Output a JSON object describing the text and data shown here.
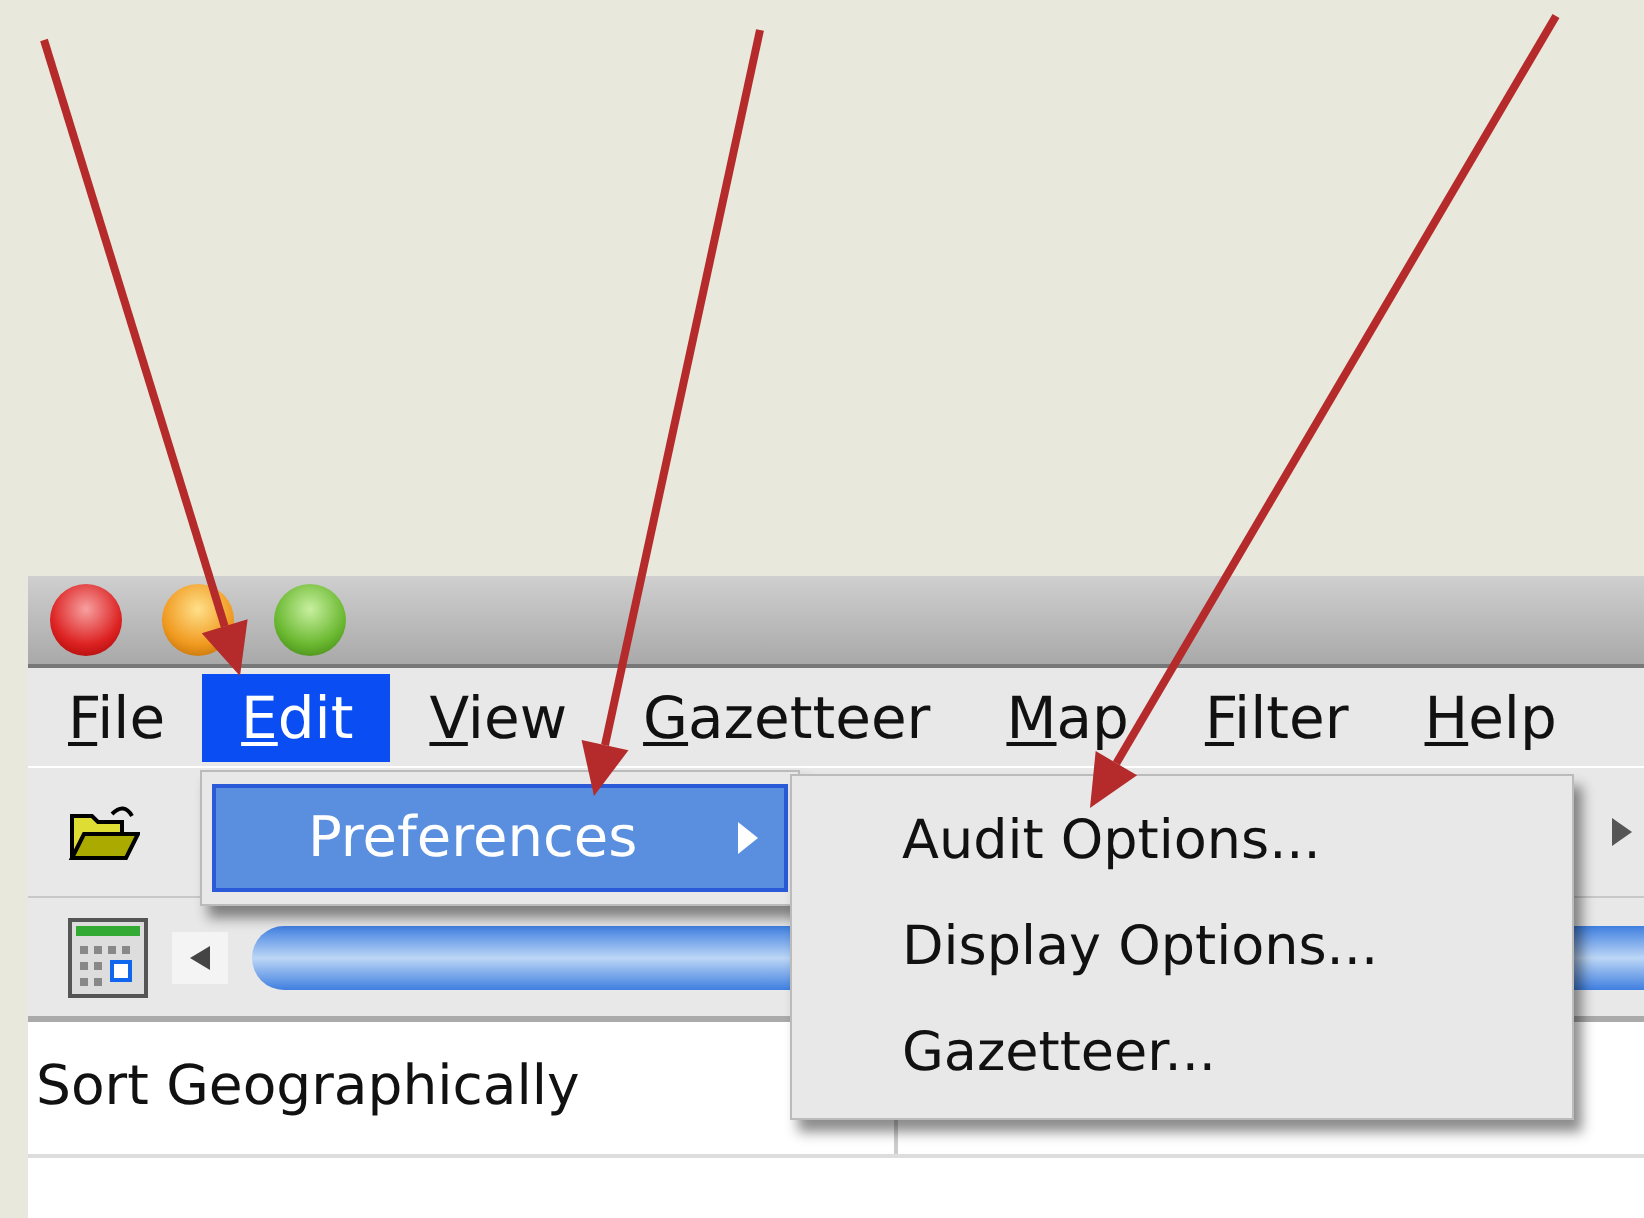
{
  "menu_bar": [
    {
      "label": "File",
      "selected": false
    },
    {
      "label": "Edit",
      "selected": true
    },
    {
      "label": "View",
      "selected": false
    },
    {
      "label": "Gazetteer",
      "selected": false
    },
    {
      "label": "Map",
      "selected": false
    },
    {
      "label": "Filter",
      "selected": false
    },
    {
      "label": "Help",
      "selected": false
    }
  ],
  "edit_menu": [
    {
      "label": "Preferences",
      "selected": true,
      "has_submenu": true
    }
  ],
  "preferences_submenu": [
    {
      "label": "Audit Options..."
    },
    {
      "label": "Display Options..."
    },
    {
      "label": "Gazetteer..."
    }
  ],
  "sort_field": {
    "value": "Sort Geographically"
  }
}
